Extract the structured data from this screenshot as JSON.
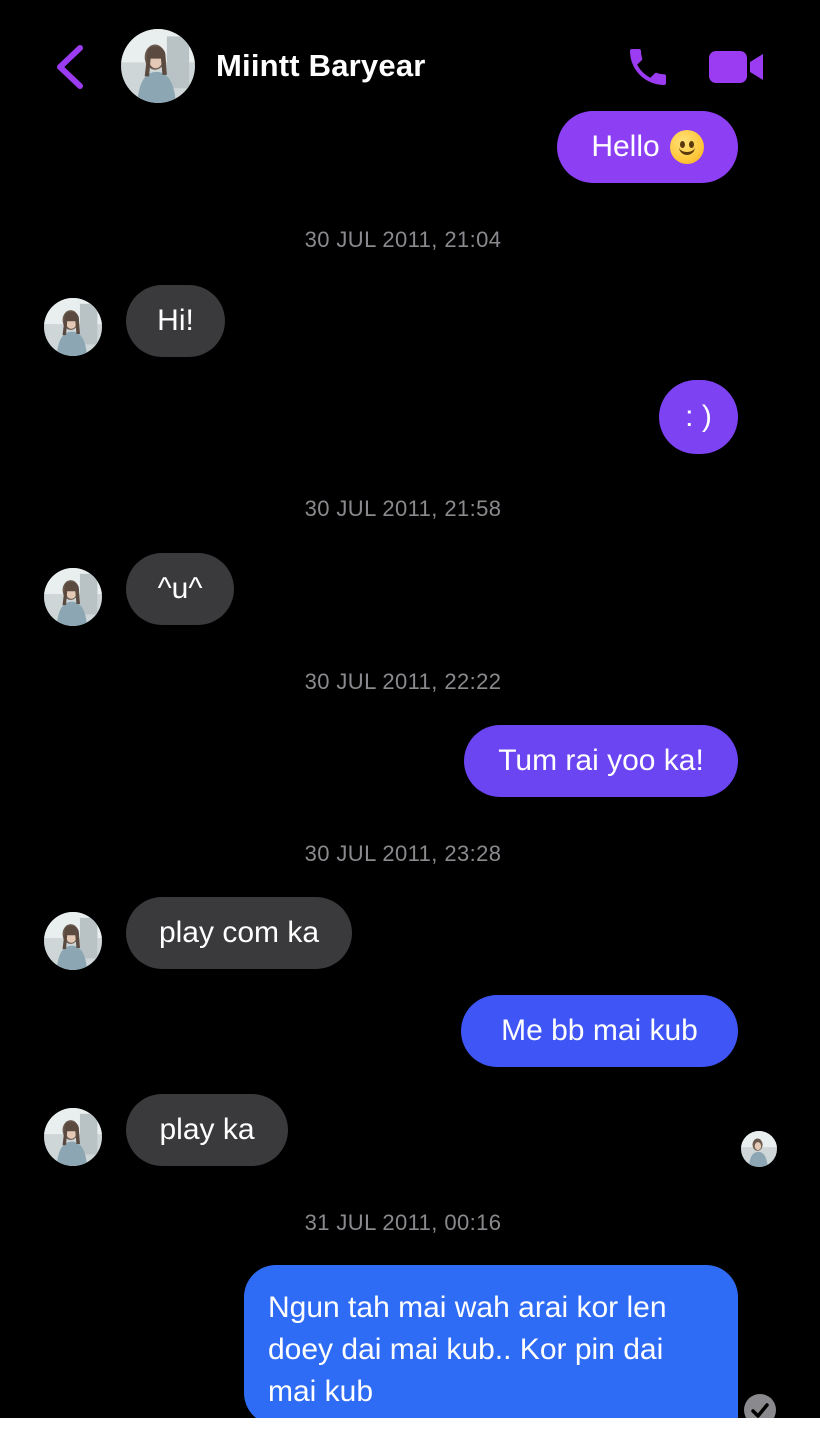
{
  "header": {
    "contact_name": "Miintt Baryear"
  },
  "icons": {
    "back": "chevron-left-icon",
    "call": "phone-icon",
    "video": "video-camera-icon"
  },
  "colors": {
    "accent": "#9b3cf2",
    "outgoing_purple": "#8c3ff3",
    "outgoing_violet": "#6b45f2",
    "outgoing_blue": "#3f55f5",
    "outgoing_bright_blue": "#2f6cf6",
    "incoming": "#3a3a3c",
    "timestamp": "#8a8a8e",
    "background": "#000000"
  },
  "conversation": {
    "msg1": {
      "sender": "me",
      "text": "Hello",
      "emoji": "slightly-smiling-face"
    },
    "ts1": "30 JUL 2011, 21:04",
    "msg2": {
      "sender": "contact",
      "text": "Hi!"
    },
    "msg3": {
      "sender": "me",
      "text": ": )"
    },
    "ts2": "30 JUL 2011, 21:58",
    "msg4": {
      "sender": "contact",
      "text": "^u^"
    },
    "ts3": "30 JUL 2011, 22:22",
    "msg5": {
      "sender": "me",
      "text": "Tum rai yoo ka!"
    },
    "ts4": "30 JUL 2011, 23:28",
    "msg6": {
      "sender": "contact",
      "text": "play com ka"
    },
    "msg7": {
      "sender": "me",
      "text": "Me bb mai kub"
    },
    "msg8": {
      "sender": "contact",
      "text": "play ka"
    },
    "ts5": "31 JUL 2011, 00:16",
    "msg9": {
      "sender": "me",
      "text": "Ngun tah mai wah arai kor len doey dai mai kub.. Kor pin dai mai kub"
    }
  }
}
